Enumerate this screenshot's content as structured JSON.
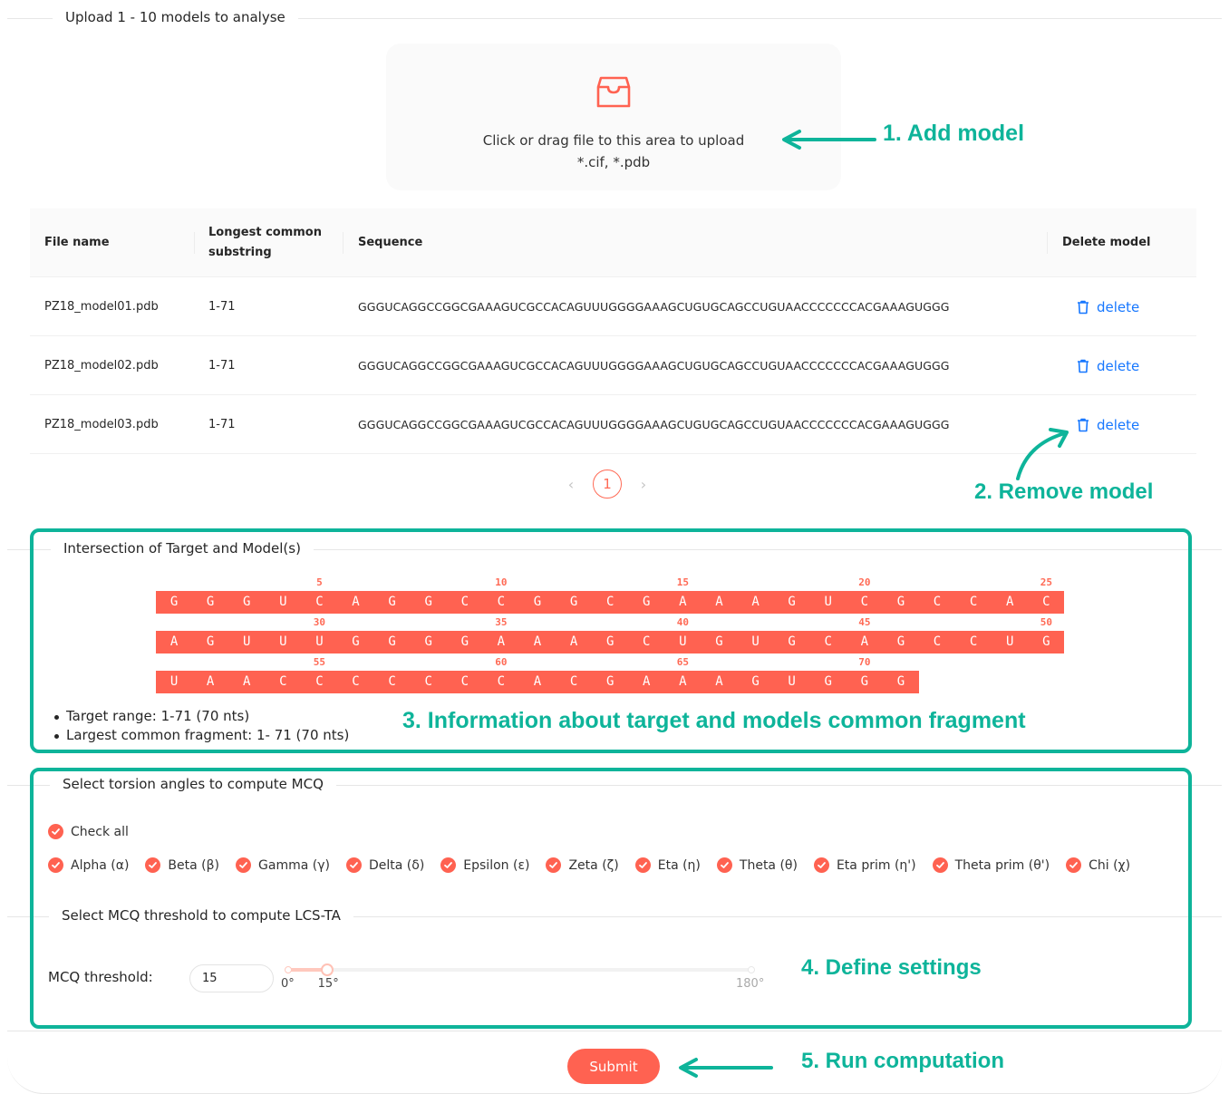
{
  "upload": {
    "section_title": "Upload 1 - 10 models to analyse",
    "icon": "inbox-icon",
    "text": "Click or drag file to this area to upload",
    "hint": "*.cif, *.pdb"
  },
  "table": {
    "headers": [
      "File name",
      "Longest common substring",
      "Sequence",
      "Delete model"
    ],
    "header_lcs_line1": "Longest common",
    "header_lcs_line2": "substring",
    "rows": [
      {
        "file": "PZ18_model01.pdb",
        "lcs": "1-71",
        "sequence": "GGGUCAGGCCGGCGAAAGUCGCCACAGUUUGGGGAAAGCUGUGCAGCCUGUAACCCCCCCACGAAAGUGGG",
        "action": "delete"
      },
      {
        "file": "PZ18_model02.pdb",
        "lcs": "1-71",
        "sequence": "GGGUCAGGCCGGCGAAAGUCGCCACAGUUUGGGGAAAGCUGUGCAGCCUGUAACCCCCCCACGAAAGUGGG",
        "action": "delete"
      },
      {
        "file": "PZ18_model03.pdb",
        "lcs": "1-71",
        "sequence": "GGGUCAGGCCGGCGAAAGUCGCCACAGUUUGGGGAAAGCUGUGCAGCCUGUAACCCCCCCACGAAAGUGGG",
        "action": "delete"
      }
    ]
  },
  "pagination": {
    "prev": "‹",
    "current": "1",
    "next": "›"
  },
  "intersection": {
    "section_title": "Intersection of Target and Model(s)",
    "sequence": "GGGUCAGGCCGGCGAAAGUCGCCACAGUUUGGGGAAAGCUGUGCAGCCUGUAACCCCCCCACGAAAGUGGG",
    "residues_per_line": 25,
    "tick_every": 5,
    "info": [
      "Target range: 1-71 (70 nts)",
      "Largest common fragment: 1- 71 (70 nts)"
    ]
  },
  "torsion": {
    "section_title": "Select torsion angles to compute MCQ",
    "check_all": {
      "label": "Check all",
      "checked": true
    },
    "angles": [
      {
        "label": "Alpha (α)",
        "checked": true
      },
      {
        "label": "Beta (β)",
        "checked": true
      },
      {
        "label": "Gamma (γ)",
        "checked": true
      },
      {
        "label": "Delta (δ)",
        "checked": true
      },
      {
        "label": "Epsilon (ε)",
        "checked": true
      },
      {
        "label": "Zeta (ζ)",
        "checked": true
      },
      {
        "label": "Eta (η)",
        "checked": true
      },
      {
        "label": "Theta (θ)",
        "checked": true
      },
      {
        "label": "Eta prim (η')",
        "checked": true
      },
      {
        "label": "Theta prim (θ')",
        "checked": true
      },
      {
        "label": "Chi (χ)",
        "checked": true
      }
    ]
  },
  "threshold": {
    "section_title": "Select MCQ threshold to compute LCS-TA",
    "label": "MCQ threshold:",
    "value": "15",
    "slider": {
      "min": 0,
      "max": 180,
      "value": 15,
      "marks": [
        "0°",
        "15°",
        "180°"
      ]
    }
  },
  "submit_label": "Submit",
  "annotations": {
    "add": "1. Add model",
    "remove": "2. Remove model",
    "info": "3. Information about target and models common fragment",
    "settings": "4. Define settings",
    "run": "5. Run computation",
    "color": "#0eb49a"
  },
  "colors": {
    "accent": "#ff6251",
    "link": "#1677ff",
    "annotation": "#0eb49a"
  }
}
